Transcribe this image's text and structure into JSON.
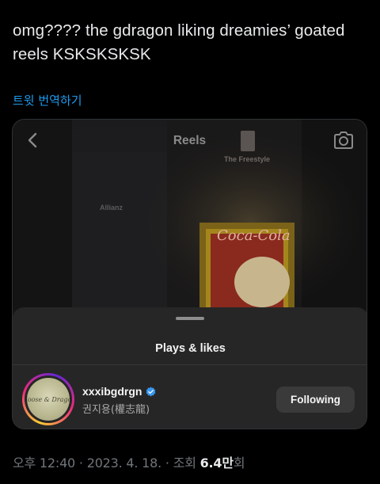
{
  "tweet": {
    "text": "omg???? the gdragon liking dreamies’ goated reels KSKSKSKSK",
    "translate_label": "트윗 번역하기"
  },
  "media": {
    "reels_title": "Reels",
    "sign_freestyle": "The Freestyle",
    "sign_allianz": "Allianz",
    "sign_coke": "Coca-Cola",
    "back_icon": "chevron-left-icon",
    "camera_icon": "camera-icon"
  },
  "sheet": {
    "title": "Plays & likes",
    "user": {
      "avatar_text": "Moose & Dragon",
      "username": "xxxibgdrgn",
      "full_name": "권지용(權志龍)",
      "verified": true,
      "follow_label": "Following"
    }
  },
  "meta": {
    "time": "오후 12:40",
    "sep1": " · ",
    "date": "2023. 4. 18.",
    "sep2": " · ",
    "views_label": "조회 ",
    "views_count": "6.4만",
    "views_suffix": "회"
  },
  "colors": {
    "background": "#000000",
    "text": "#e7e9ea",
    "link": "#1d9bf0",
    "muted": "#71767b",
    "sheet": "#262626",
    "verified": "#3797f0"
  }
}
